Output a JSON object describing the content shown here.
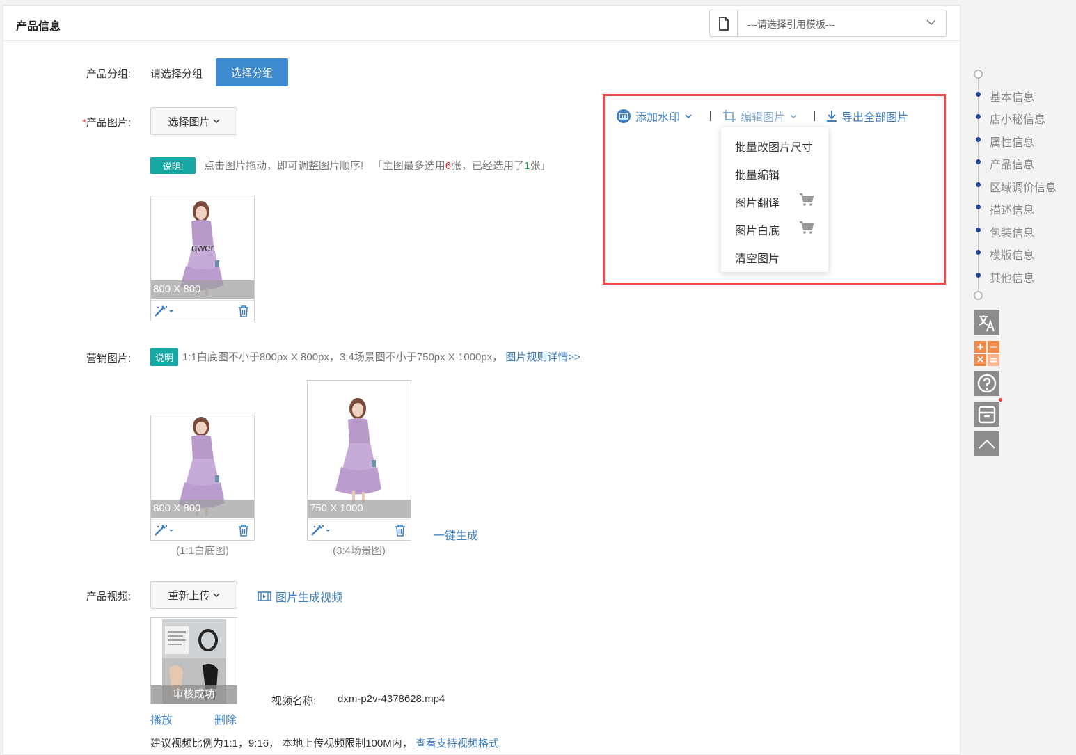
{
  "header": {
    "title": "产品信息",
    "template_select": "---请选择引用模板---"
  },
  "group": {
    "label": "产品分组",
    "value": "请选择分组",
    "button": "选择分组"
  },
  "product_images": {
    "required_mark": "*",
    "label": "产品图片",
    "select_button": "选择图片",
    "note_tag": "说明!",
    "note_text": "点击图片拖动，即可调整图片顺序!",
    "note_limit_pre": "「主图最多选用",
    "note_max": "6",
    "note_limit_mid": "张，已经选用了",
    "note_used": "1",
    "note_limit_post": "张」",
    "thumb_dim": "800 X 800",
    "watermark_text": "qwer"
  },
  "toolbar": {
    "add_watermark": "添加水印",
    "edit_images": "编辑图片",
    "export_all": "导出全部图片",
    "menu": {
      "resize": "批量改图片尺寸",
      "batch_edit": "批量编辑",
      "translate": "图片翻译",
      "white_bg": "图片白底",
      "clear": "清空图片"
    }
  },
  "marketing": {
    "label": "营销图片",
    "note_tag": "说明",
    "note_text": "1:1白底图不小于800px X 800px，3:4场景图不小于750px X 1000px，",
    "rules_link": "图片规则详情>>",
    "square_dim": "800 X 800",
    "square_caption": "(1:1白底图)",
    "scene_dim": "750 X 1000",
    "scene_caption": "(3:4场景图)",
    "generate_link": "一键生成"
  },
  "video": {
    "label": "产品视频",
    "reupload_button": "重新上传",
    "gen_video_link": "图片生成视频",
    "status": "审核成功",
    "play": "播放",
    "delete": "删除",
    "name_label": "视频名称:",
    "name_value": "dxm-p2v-4378628.mp4",
    "hint": "建议视频比例为1:1，9:16， 本地上传视频限制100M内，",
    "formats_link": "查看支持视频格式"
  },
  "side_nav": {
    "items": [
      "基本信息",
      "店小秘信息",
      "属性信息",
      "产品信息",
      "区域调价信息",
      "描述信息",
      "包装信息",
      "模版信息",
      "其他信息"
    ]
  },
  "colors": {
    "primary": "#3d8ad1",
    "link": "#3d7fc2",
    "note_tag": "#15a8a5",
    "highlight_box": "#f04848",
    "nav_dot": "#23489a"
  }
}
